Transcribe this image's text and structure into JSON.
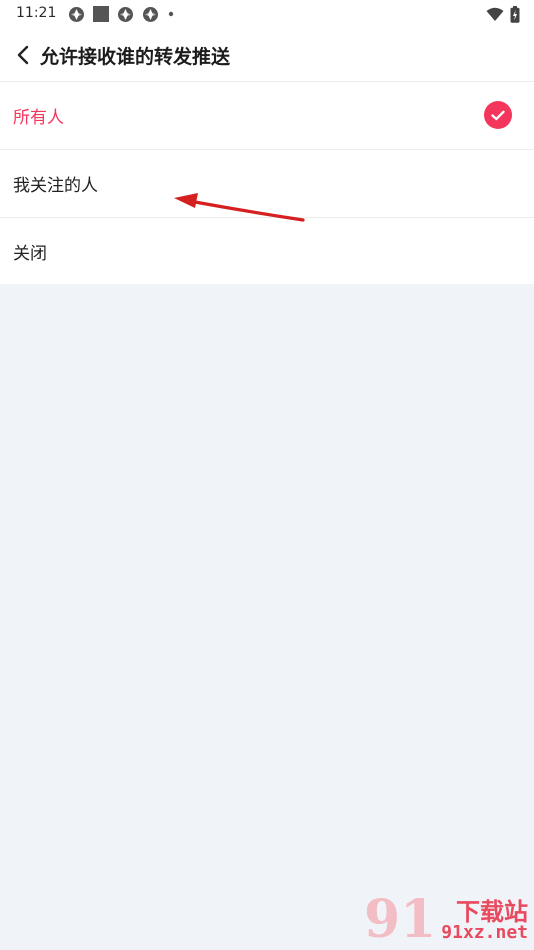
{
  "status_bar": {
    "time": "11:21"
  },
  "header": {
    "title": "允许接收谁的转发推送"
  },
  "options": [
    {
      "label": "所有人",
      "selected": true
    },
    {
      "label": "我关注的人",
      "selected": false
    },
    {
      "label": "关闭",
      "selected": false
    }
  ],
  "watermark": {
    "number": "91",
    "text": "下载站",
    "domain": "91xz.net"
  },
  "colors": {
    "accent": "#f5365c",
    "background": "#f0f3f7",
    "annotation_arrow": "#d42020"
  }
}
